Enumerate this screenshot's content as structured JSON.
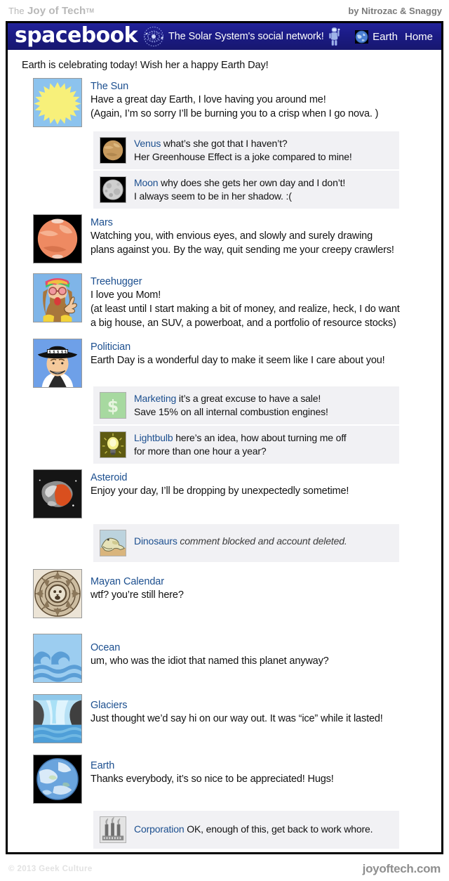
{
  "masthead": {
    "the": "The",
    "title": "Joy of Tech",
    "tm": "TM",
    "byline": "by Nitrozac & Snaggy"
  },
  "navbar": {
    "brand": "spacebook",
    "orbit_icon": "orbit-icon",
    "tagline": "The Solar System's social network!",
    "astronaut_icon": "astronaut-icon",
    "earth_icon": "earth-globe-icon",
    "earth_label": "Earth",
    "home_label": "Home"
  },
  "wall": {
    "intro": "Earth is celebrating today! Wish her a happy Earth Day!"
  },
  "posts": [
    {
      "avatar": "sun-avatar",
      "author": "The Sun",
      "lines": [
        "Have a great day Earth,  I love having you around me!",
        "(Again, I’m so sorry I’ll be burning you to a crisp when I go nova.  )"
      ],
      "comments": [
        {
          "avatar": "venus-avatar",
          "author": "Venus",
          "first_rest": " what’s she got that I haven’t?",
          "lines": [
            "Her Greenhouse Effect is a joke compared to mine!"
          ]
        },
        {
          "avatar": "moon-avatar",
          "author": "Moon",
          "first_rest": "  why does she gets her own day and I don’t!",
          "lines": [
            "I always seem to be in her shadow.  :("
          ]
        }
      ]
    },
    {
      "avatar": "mars-avatar",
      "author": "Mars",
      "lines": [
        "Watching you, with envious eyes, and slowly and surely drawing",
        "plans against you.  By the way, quit sending me your creepy crawlers!"
      ],
      "comments": []
    },
    {
      "avatar": "treehugger-avatar",
      "author": "Treehugger",
      "lines": [
        "I love you Mom!",
        "(at least until I start making a bit of money, and realize, heck,  I do want",
        "a big house, an SUV, a powerboat, and a portfolio of resource stocks)"
      ],
      "comments": []
    },
    {
      "avatar": "politician-avatar",
      "author": "Politician",
      "lines": [
        "Earth Day is a wonderful day to make it seem like I care about you!"
      ],
      "comments": [
        {
          "avatar": "marketing-avatar",
          "author": "Marketing",
          "first_rest": " it’s a great excuse to have a sale!",
          "lines": [
            "Save 15% on all internal combustion engines!"
          ]
        },
        {
          "avatar": "lightbulb-avatar",
          "author": "Lightbulb",
          "first_rest": "  here’s an idea, how about turning me off",
          "lines": [
            "for more than one hour a year?"
          ]
        }
      ]
    },
    {
      "avatar": "asteroid-avatar",
      "author": "Asteroid",
      "lines": [
        "Enjoy your day,  I’ll be dropping by unexpectedly sometime!"
      ],
      "comments": [
        {
          "avatar": "dinosaurs-avatar",
          "author": "Dinosaurs",
          "first_rest": "  comment blocked and account deleted.",
          "italic": true,
          "lines": []
        }
      ]
    },
    {
      "avatar": "mayan-avatar",
      "author": "Mayan Calendar",
      "lines": [
        "wtf? you’re still here?"
      ],
      "comments": []
    },
    {
      "avatar": "ocean-avatar",
      "author": "Ocean",
      "lines": [
        "um, who was the idiot that named this planet anyway?"
      ],
      "comments": []
    },
    {
      "avatar": "glaciers-avatar",
      "author": "Glaciers",
      "lines": [
        "Just thought we’d say hi on our way out.  It was “ice” while it lasted!"
      ],
      "comments": []
    },
    {
      "avatar": "earth-avatar",
      "author": "Earth",
      "lines": [
        "Thanks everybody, it’s so nice to be appreciated! Hugs!"
      ],
      "comments": [
        {
          "avatar": "corporation-avatar",
          "author": "Corporation",
          "first_rest": " OK, enough of this, get back to work whore.",
          "lines": []
        }
      ]
    }
  ],
  "footer": {
    "copyright": "© 2013 Geek Culture",
    "site": "joyoftech.com"
  },
  "colors": {
    "nav_blue": "#1b1b85",
    "author_link": "#1c4f8f",
    "comment_bg": "#f1f1f4",
    "masthead_gray": "#b8b8b8"
  }
}
